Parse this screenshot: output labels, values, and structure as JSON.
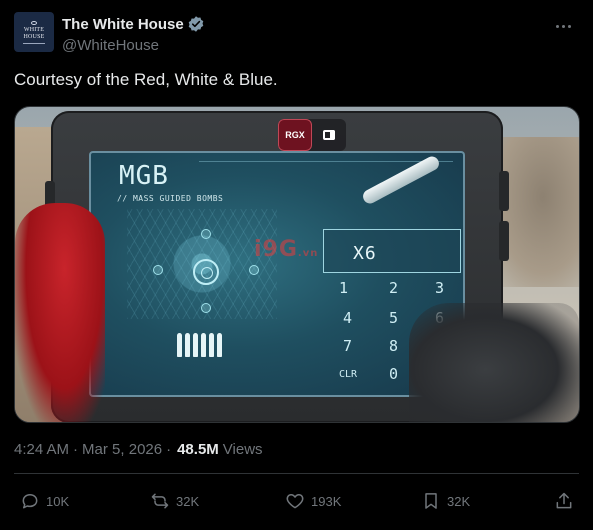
{
  "author": {
    "display_name": "The White House",
    "handle": "@WhiteHouse",
    "avatar_text_line1": "WHITE",
    "avatar_text_line2": "HOUSE",
    "verified_icon": "verified-badge-icon",
    "verified_color": "#829aab"
  },
  "tweet": {
    "text": "Courtesy of the Red, White & Blue."
  },
  "media": {
    "overlay_tag": "RGX",
    "screen_title": "MGB",
    "screen_subtitle": "// MASS GUIDED BOMBS",
    "quantity_display": "X6",
    "keypad": [
      "1",
      "2",
      "3",
      "4",
      "5",
      "6",
      "7",
      "8",
      "CLR",
      "0"
    ],
    "watermark": "i9G",
    "watermark_suffix": ".vn"
  },
  "meta": {
    "time": "4:24 AM",
    "separator": "·",
    "date": "Mar 5, 2026",
    "views_count": "48.5M",
    "views_label": "Views"
  },
  "actions": {
    "replies": "10K",
    "reposts": "32K",
    "likes": "193K",
    "bookmarks": "32K"
  },
  "colors": {
    "background": "#000000",
    "text_primary": "#e7e9ea",
    "text_secondary": "#71767b",
    "divider": "#2f3336"
  }
}
